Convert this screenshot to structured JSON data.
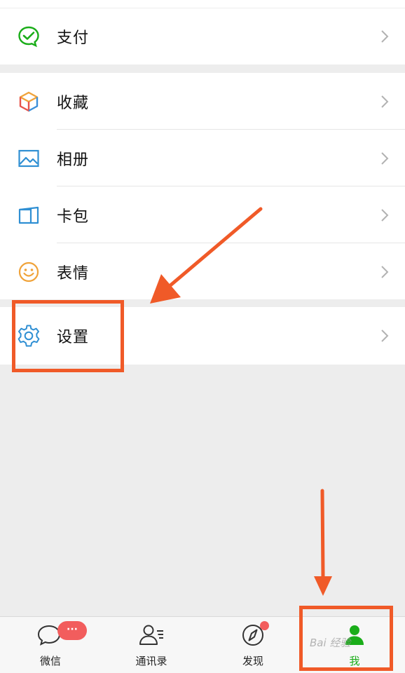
{
  "menu": {
    "pay": {
      "label": "支付",
      "icon": "pay-check-icon"
    },
    "favorites": {
      "label": "收藏",
      "icon": "cube-icon"
    },
    "album": {
      "label": "相册",
      "icon": "image-icon"
    },
    "wallet": {
      "label": "卡包",
      "icon": "card-wallet-icon"
    },
    "stickers": {
      "label": "表情",
      "icon": "smiley-icon"
    },
    "settings": {
      "label": "设置",
      "icon": "gear-icon"
    }
  },
  "tabbar": {
    "chats": {
      "label": "微信",
      "badge": "···"
    },
    "contacts": {
      "label": "通讯录"
    },
    "discover": {
      "label": "发现"
    },
    "me": {
      "label": "我"
    }
  },
  "watermark": "Bai 经验",
  "colors": {
    "accent_green": "#1aad19",
    "annotation_orange": "#f05a28",
    "badge_red": "#f25d5d"
  }
}
